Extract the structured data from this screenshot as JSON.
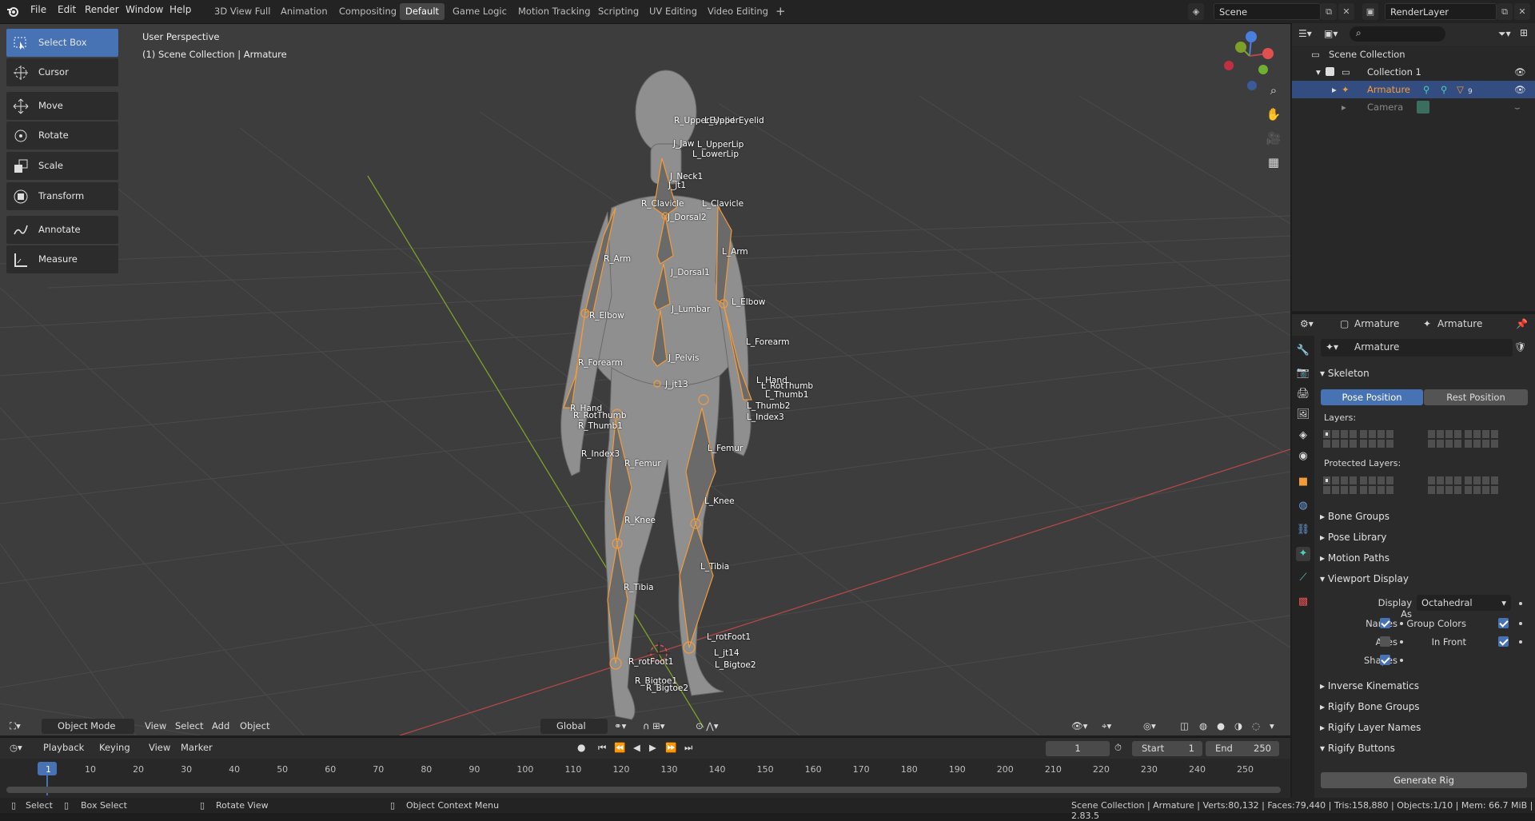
{
  "menus": [
    "File",
    "Edit",
    "Render",
    "Window",
    "Help"
  ],
  "workspaces": [
    "3D View Full",
    "Animation",
    "Compositing",
    "Default",
    "Game Logic",
    "Motion Tracking",
    "Scripting",
    "UV Editing",
    "Video Editing"
  ],
  "active_workspace": "Default",
  "scene_name": "Scene",
  "render_layer": "RenderLayer",
  "tools": [
    "Select Box",
    "Cursor",
    "Move",
    "Rotate",
    "Scale",
    "Transform",
    "Annotate",
    "Measure"
  ],
  "viewport": {
    "perspective": "User Perspective",
    "collection_info": "(1) Scene Collection | Armature",
    "mode": "Object Mode",
    "menus": [
      "View",
      "Select",
      "Add",
      "Object"
    ],
    "orientation": "Global"
  },
  "bones": [
    "R_UpperEyelid",
    "L_UpperEyelid",
    "J_Jaw",
    "L_UpperLip",
    "L_LowerLip",
    "J_Neck1",
    "J_jt1",
    "R_Clavicle",
    "L_Clavicle",
    "J_Dorsal2",
    "R_Arm",
    "L_Arm",
    "J_Dorsal1",
    "R_Elbow",
    "L_Elbow",
    "J_Lumbar",
    "L_Forearm",
    "R_Forearm",
    "J_Pelvis",
    "J_jt13",
    "L_Hand",
    "L_RotThumb",
    "L_Thumb1",
    "L_Thumb2",
    "L_Index3",
    "R_Hand",
    "R_RotThumb",
    "R_Thumb1",
    "R_Index3",
    "R_Femur",
    "L_Femur",
    "L_Knee",
    "R_Knee",
    "L_Tibia",
    "R_Tibia",
    "L_rotFoot1",
    "R_rotFoot1",
    "L_jt14",
    "L_Bigtoe2",
    "R_Bigtoe1",
    "R_Bigtoe2"
  ],
  "timeline": {
    "menus": [
      "Playback",
      "Keying",
      "View",
      "Marker"
    ],
    "current_frame": "1",
    "start_label": "Start",
    "start": "1",
    "end_label": "End",
    "end": "250",
    "ticks": [
      "1",
      "10",
      "20",
      "30",
      "40",
      "50",
      "60",
      "70",
      "80",
      "90",
      "100",
      "110",
      "120",
      "130",
      "140",
      "150",
      "160",
      "170",
      "180",
      "190",
      "200",
      "210",
      "220",
      "230",
      "240",
      "250"
    ]
  },
  "status": {
    "select": "Select",
    "box_select": "Box Select",
    "rotate_view": "Rotate View",
    "context_menu": "Object Context Menu",
    "stats": "Scene Collection | Armature | Verts:80,132 | Faces:79,440 | Tris:158,880 | Objects:1/10 | Mem: 66.7 MiB | 2.83.5"
  },
  "outliner": {
    "root": "Scene Collection",
    "collection": "Collection 1",
    "items": [
      "Armature",
      "Camera"
    ],
    "badge": "9"
  },
  "properties": {
    "header_object": "Armature",
    "header_data": "Armature",
    "data_name": "Armature",
    "skeleton_label": "Skeleton",
    "pose_position": "Pose Position",
    "rest_position": "Rest Position",
    "layers_label": "Layers:",
    "protected_layers_label": "Protected Layers:",
    "collapsed_panels": [
      "Bone Groups",
      "Pose Library",
      "Motion Paths"
    ],
    "viewport_display": "Viewport Display",
    "display_as_label": "Display As",
    "display_as_value": "Octahedral",
    "names_label": "Names",
    "axes_label": "Axes",
    "shapes_label": "Shapes",
    "group_colors_label": "Group Colors",
    "in_front_label": "In Front",
    "names": true,
    "axes": false,
    "shapes": true,
    "group_colors": true,
    "in_front": true,
    "more_panels": [
      "Inverse Kinematics",
      "Rigify Bone Groups",
      "Rigify Layer Names",
      "Rigify Buttons"
    ],
    "generate_rig": "Generate Rig"
  },
  "colors": {
    "accent": "#4772b3",
    "selection_orange": "#f29b3a",
    "x_axis": "#cc4444",
    "y_axis": "#7ea02a"
  }
}
